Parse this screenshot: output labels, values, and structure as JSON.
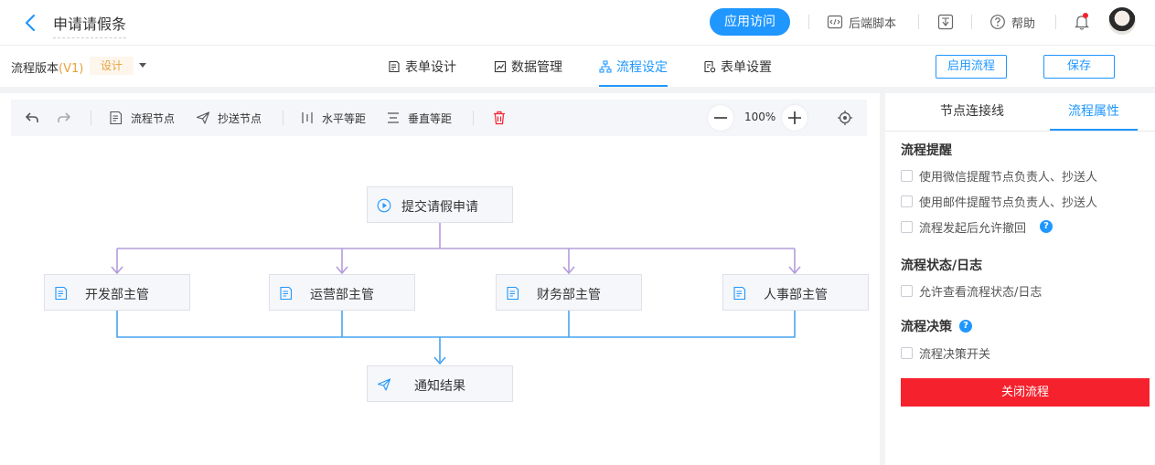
{
  "header": {
    "title": "申请请假条",
    "visit_button": "应用访问",
    "backend_script": "后端脚本",
    "help": "帮助"
  },
  "subbar": {
    "version_label": "流程版本",
    "version_value": "(V1)",
    "design_tag": "设计",
    "tabs": [
      {
        "label": "表单设计",
        "icon": "form-design-icon"
      },
      {
        "label": "数据管理",
        "icon": "data-chart-icon"
      },
      {
        "label": "流程设定",
        "icon": "flow-icon",
        "active": true
      },
      {
        "label": "表单设置",
        "icon": "form-settings-icon"
      }
    ],
    "enable_flow": "启用流程",
    "save": "保存"
  },
  "toolbar": {
    "flow_node": "流程节点",
    "cc_node": "抄送节点",
    "h_equal": "水平等距",
    "v_equal": "垂直等距",
    "zoom": "100%"
  },
  "flow": {
    "start": "提交请假申请",
    "approvers": [
      "开发部主管",
      "运营部主管",
      "财务部主管",
      "人事部主管"
    ],
    "end": "通知结果"
  },
  "panel": {
    "tabs": [
      "节点连接线",
      "流程属性"
    ],
    "active_tab": "流程属性",
    "reminder_title": "流程提醒",
    "reminder_items": [
      "使用微信提醒节点负责人、抄送人",
      "使用邮件提醒节点负责人、抄送人",
      "流程发起后允许撤回"
    ],
    "status_title": "流程状态/日志",
    "status_items": [
      "允许查看流程状态/日志"
    ],
    "decision_title": "流程决策",
    "decision_items": [
      "流程决策开关"
    ],
    "close_button": "关闭流程"
  },
  "colors": {
    "accent": "#1f97ff",
    "danger": "#f5222d",
    "branch_line": "#b39ddb",
    "merge_line": "#4aa3ef",
    "design_tag": "#e6a23c"
  }
}
